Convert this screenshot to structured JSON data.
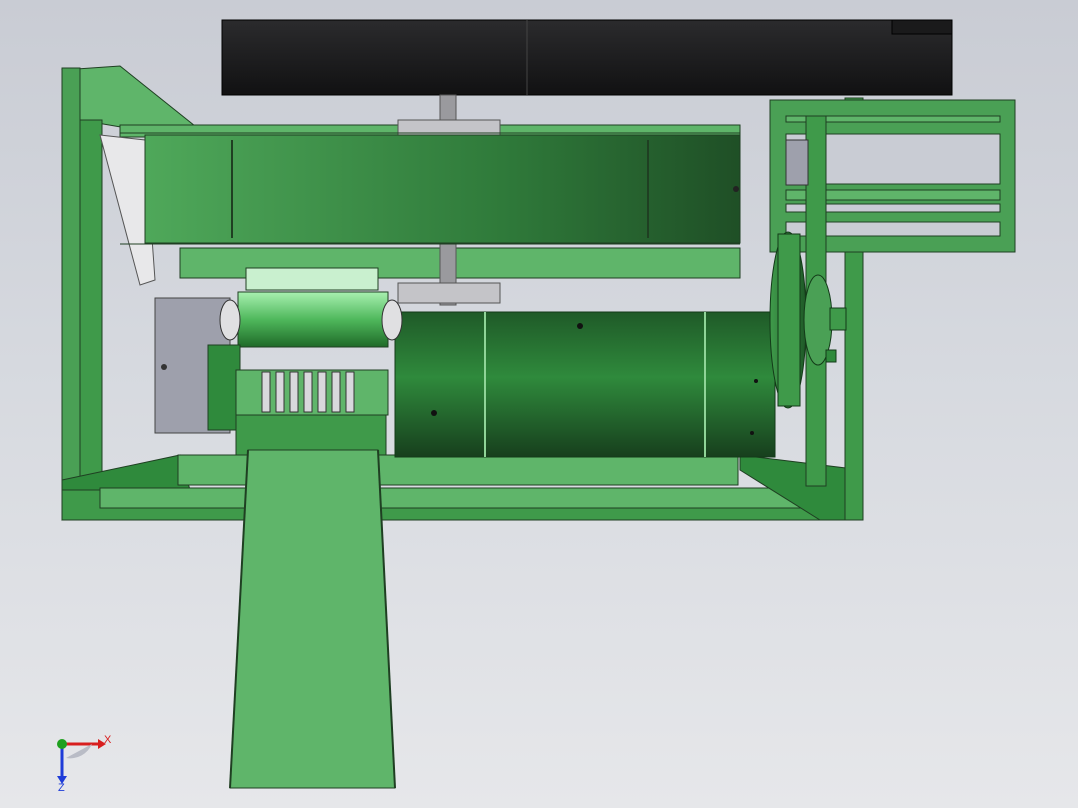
{
  "viewport": {
    "axis_triad": {
      "x_label": "X",
      "z_label": "Z",
      "x_color": "#d81e1e",
      "z_color": "#1e3cd8",
      "y_color": "#1ea01e"
    }
  },
  "model": {
    "frame_color": "#3f9a4a",
    "frame_dark": "#1f5a28",
    "hopper_color": "#2f1f2a",
    "drum_color": "#2d7a36",
    "chute_color": "#5fb56a",
    "shaft_color": "#9a9a9e"
  }
}
